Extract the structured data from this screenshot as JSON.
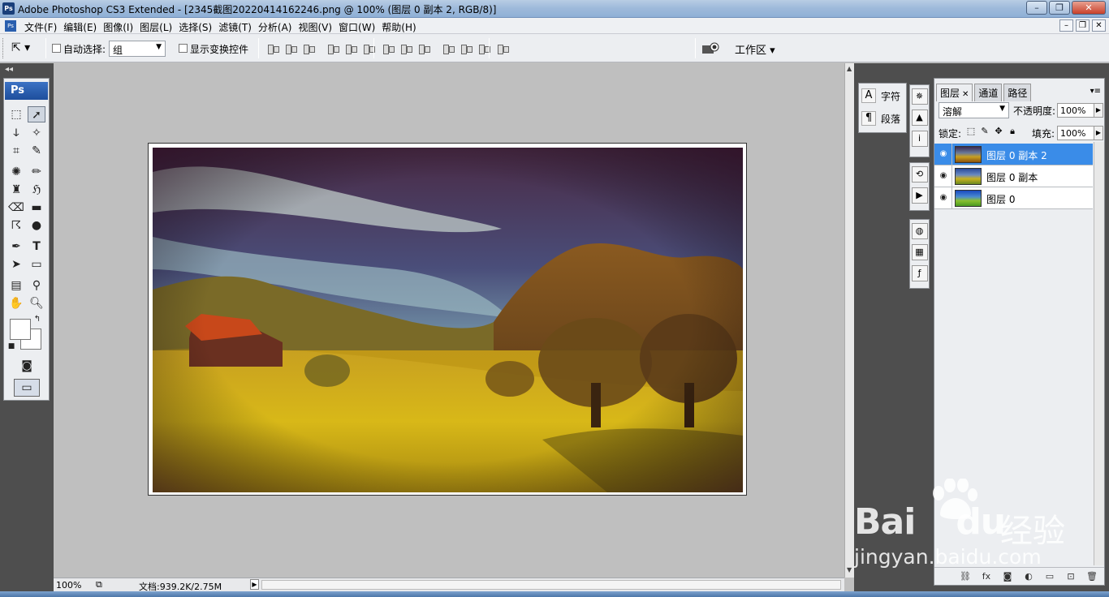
{
  "window": {
    "title": "Adobe Photoshop CS3 Extended - [2345截图20220414162246.png @ 100% (图层 0 副本 2, RGB/8)]",
    "app_icon": "Ps"
  },
  "menu": {
    "items": [
      "文件(F)",
      "编辑(E)",
      "图像(I)",
      "图层(L)",
      "选择(S)",
      "滤镜(T)",
      "分析(A)",
      "视图(V)",
      "窗口(W)",
      "帮助(H)"
    ]
  },
  "options_bar": {
    "auto_select_label": "自动选择:",
    "auto_select_value": "组",
    "show_transform_label": "显示变换控件",
    "workspace_label": "工作区 ▾"
  },
  "toolbox": {
    "logo": "Ps"
  },
  "mini_panel": {
    "character_label": "字符",
    "paragraph_label": "段落"
  },
  "layers_panel": {
    "tabs": [
      "图层",
      "通道",
      "路径"
    ],
    "blend_mode": "溶解",
    "opacity_label": "不透明度:",
    "opacity_value": "100%",
    "lock_label": "锁定:",
    "fill_label": "填充:",
    "fill_value": "100%",
    "layers": [
      {
        "name": "图层 0 副本 2",
        "selected": true
      },
      {
        "name": "图层 0 副本",
        "selected": false
      },
      {
        "name": "图层 0",
        "selected": false
      }
    ]
  },
  "status_bar": {
    "zoom": "100%",
    "doc_info": "文档:939.2K/2.75M"
  },
  "watermark": {
    "brand": "Bai",
    "brand2": "du",
    "site_name": "经验",
    "url": "jingyan.baidu.com"
  },
  "colors": {
    "selection_blue": "#3a8ce8",
    "panel_bg": "#eceef1",
    "dock_bg": "#4e4e4e",
    "canvas_bg": "#bfbfbf"
  }
}
